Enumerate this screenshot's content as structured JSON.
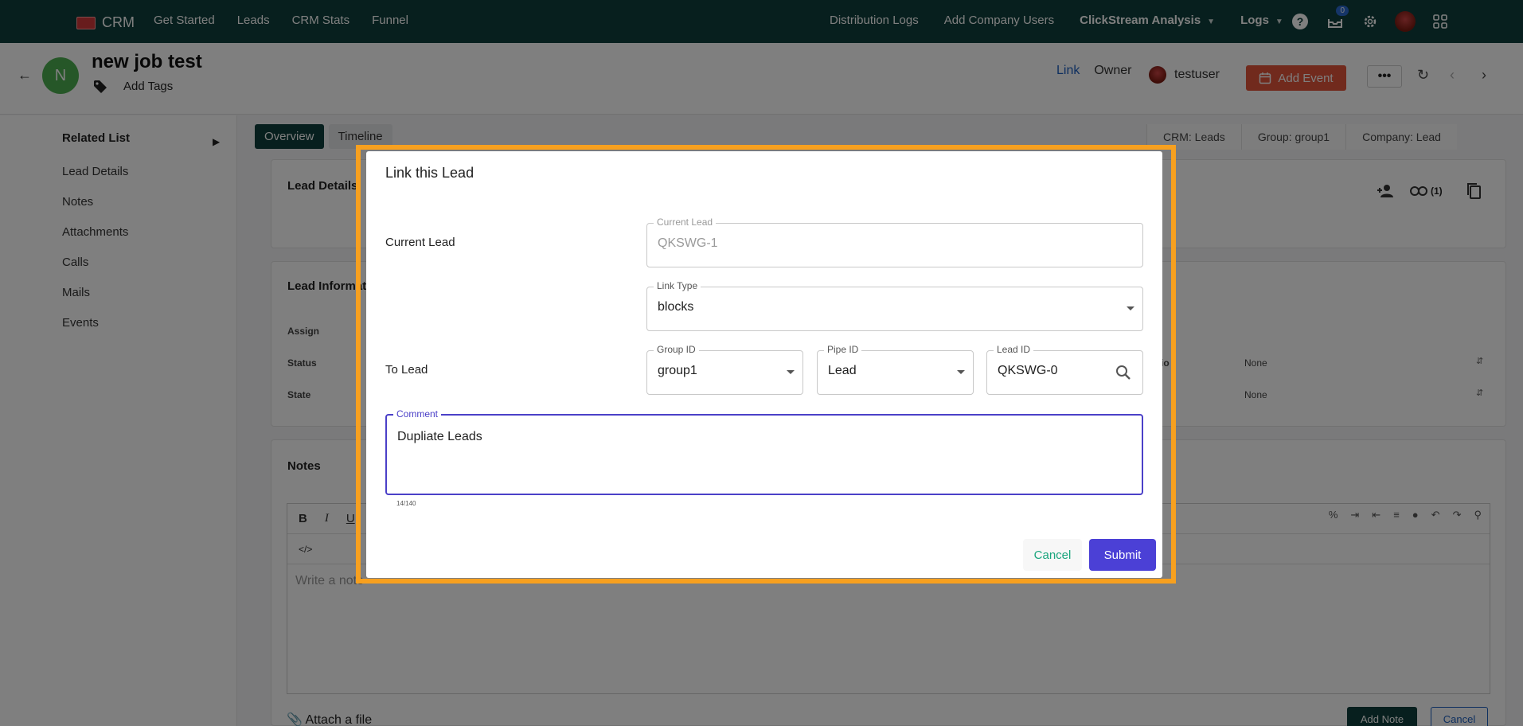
{
  "topnav": {
    "brand": "CRM",
    "left_items": [
      "Get Started",
      "Leads",
      "CRM Stats",
      "Funnel"
    ],
    "right_items": [
      {
        "label": "Distribution Logs",
        "has_caret": false
      },
      {
        "label": "Add Company Users",
        "has_caret": false
      },
      {
        "label": "ClickStream Analysis",
        "has_caret": true
      },
      {
        "label": "Logs",
        "has_caret": true
      }
    ],
    "notification_count": "0"
  },
  "header": {
    "avatar_letter": "N",
    "title": "new job test",
    "add_tags": "Add Tags",
    "link": "Link",
    "owner_label": "Owner",
    "owner_name": "testuser",
    "add_event": "Add Event",
    "more": "•••"
  },
  "sidebar": {
    "title": "Related List",
    "items": [
      "Lead Details",
      "Notes",
      "Attachments",
      "Calls",
      "Mails",
      "Events"
    ]
  },
  "main": {
    "tabs": [
      "Overview",
      "Timeline"
    ],
    "breadcrumbs": [
      "CRM: Leads",
      "Group: group1",
      "Company: Lead"
    ],
    "lead_details_title": "Lead Details",
    "link_count": "(1)",
    "lead_info_title": "Lead Informat",
    "fields": [
      "Assign",
      "Status",
      "State"
    ],
    "right_values": [
      "None",
      "None"
    ],
    "right_partial_label": "io",
    "notes_title": "Notes",
    "note_placeholder": "Write a note",
    "attach": "Attach a file",
    "add_note": "Add Note",
    "cancel": "Cancel"
  },
  "modal": {
    "title": "Link this Lead",
    "current_lead_label": "Current Lead",
    "current_lead_legend": "Current Lead",
    "current_lead_value": "QKSWG-1",
    "link_type_legend": "Link Type",
    "link_type_value": "blocks",
    "to_lead_label": "To Lead",
    "group_id_legend": "Group ID",
    "group_id_value": "group1",
    "pipe_id_legend": "Pipe ID",
    "pipe_id_value": "Lead",
    "lead_id_legend": "Lead ID",
    "lead_id_value": "QKSWG-0",
    "comment_legend": "Comment",
    "comment_value": "Dupliate Leads",
    "counter": "14/140",
    "cancel": "Cancel",
    "submit": "Submit"
  },
  "colors": {
    "nav_bg": "#0f3f3c",
    "accent": "#4b40d6",
    "highlight_frame": "#f7a01f",
    "add_event_bg": "#e3553a"
  }
}
